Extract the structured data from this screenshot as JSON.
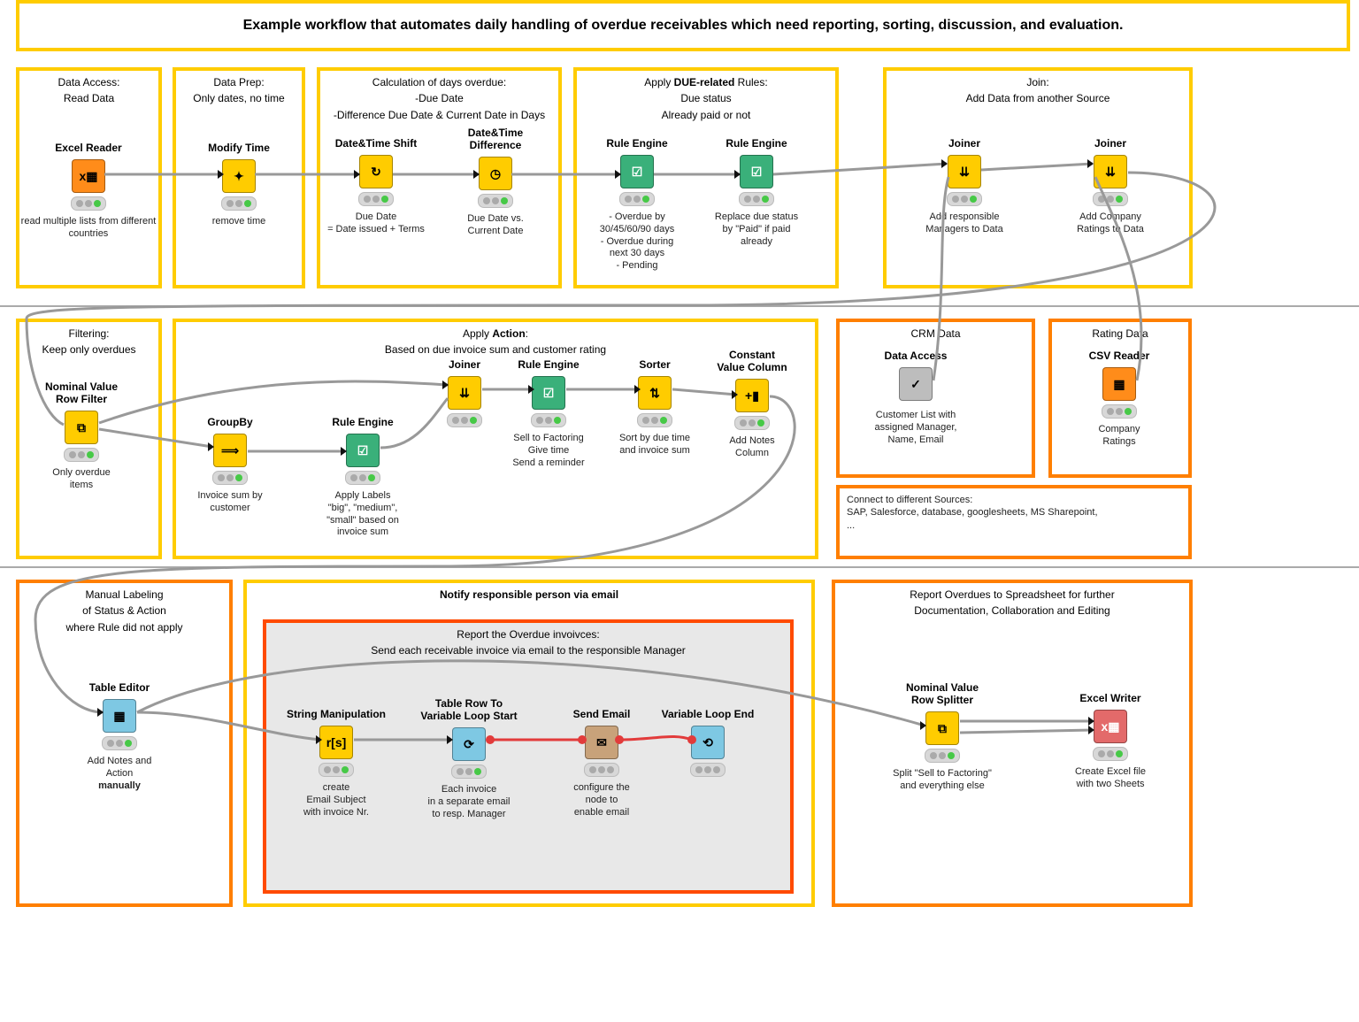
{
  "title": "Example workflow that automates daily handling of overdue receivables which need reporting, sorting, discussion, and evaluation.",
  "zones": {
    "z1": {
      "l1": "Data Access:",
      "l2": "Read Data"
    },
    "z2": {
      "l1": "Data Prep:",
      "l2": "Only dates, no time"
    },
    "z3": {
      "l1": "Calculation of days overdue:",
      "l2": "-Due Date",
      "l3": "-Difference Due Date & Current Date in Days"
    },
    "z4": {
      "l1": "Apply DUE-related Rules:",
      "l2": "Due status",
      "l3": "Already paid or not"
    },
    "z5": {
      "l1": "Join:",
      "l2": "Add Data from another Source"
    },
    "z6": {
      "l1": "Filtering:",
      "l2": "Keep only overdues"
    },
    "z7": {
      "l1": "Apply Action:",
      "l2": "Based on due invoice sum and customer rating"
    },
    "z8": {
      "l1": "CRM Data"
    },
    "z9": {
      "l1": "Rating Data"
    },
    "z10": {
      "l1": "Manual Labeling",
      "l2": "of Status & Action",
      "l3": "where Rule did not apply"
    },
    "z11": {
      "l1": "Notify responsible person via email"
    },
    "z11b": {
      "l1": "Report the Overdue invoivces:",
      "l2": "Send each receivable invoice via email to the responsible Manager"
    },
    "z12": {
      "l1": "Report Overdues to Spreadsheet for further",
      "l2": "Documentation, Collaboration and Editing"
    },
    "src": {
      "l1": "Connect to different Sources:",
      "l2": "SAP, Salesforce, database, googlesheets, MS Sharepoint,",
      "l3": "..."
    }
  },
  "nodes": {
    "excel": {
      "t": "Excel Reader",
      "d": "read multiple lists from different countries"
    },
    "modtime": {
      "t": "Modify Time",
      "d": "remove time"
    },
    "dtshift": {
      "t": "Date&Time Shift",
      "d": "Due Date\n= Date issued + Terms"
    },
    "dtdiff": {
      "t": "Date&Time\nDifference",
      "d": "Due Date vs.\nCurrent Date"
    },
    "rule1": {
      "t": "Rule Engine",
      "d": "- Overdue by\n30/45/60/90 days\n- Overdue during\nnext 30 days\n- Pending"
    },
    "rule2": {
      "t": "Rule Engine",
      "d": "Replace due status\nby \"Paid\" if paid\nalready"
    },
    "join1": {
      "t": "Joiner",
      "d": "Add responsible\nManagers to Data"
    },
    "join2": {
      "t": "Joiner",
      "d": "Add Company\nRatings to Data"
    },
    "nvf": {
      "t": "Nominal Value\nRow Filter",
      "d": "Only overdue\nitems"
    },
    "groupby": {
      "t": "GroupBy",
      "d": "Invoice sum by\ncustomer"
    },
    "rule3": {
      "t": "Rule Engine",
      "d": "Apply Labels\n\"big\", \"medium\",\n\"small\" based on\ninvoice sum"
    },
    "join3": {
      "t": "Joiner",
      "d": ""
    },
    "rule4": {
      "t": "Rule Engine",
      "d": "Sell to Factoring\nGive time\nSend a reminder"
    },
    "sorter": {
      "t": "Sorter",
      "d": "Sort by due time\nand invoice sum"
    },
    "constcol": {
      "t": "Constant\nValue Column",
      "d": "Add Notes\nColumn"
    },
    "dacc": {
      "t": "Data Access",
      "d": "Customer List with\nassigned Manager,\nName, Email"
    },
    "csvr": {
      "t": "CSV Reader",
      "d": "Company\nRatings"
    },
    "tedit": {
      "t": "Table Editor",
      "d": "Add Notes and\nAction\nmanually"
    },
    "strman": {
      "t": "String Manipulation",
      "d": "create\nEmail Subject\nwith invoice Nr."
    },
    "tloop": {
      "t": "Table Row To\nVariable Loop Start",
      "d": "Each invoice\nin a separate email\nto resp. Manager"
    },
    "semail": {
      "t": "Send Email",
      "d": "configure the\nnode to\nenable email"
    },
    "vloop": {
      "t": "Variable Loop End",
      "d": ""
    },
    "nvsplit": {
      "t": "Nominal Value\nRow Splitter",
      "d": "Split \"Sell to Factoring\"\nand everything else"
    },
    "xlswrite": {
      "t": "Excel Writer",
      "d": "Create Excel file\nwith two Sheets"
    }
  },
  "diagram_notes": {
    "sep_rows": [
      345,
      640
    ],
    "colors": {
      "yellow": "#ffcc00",
      "orange": "#ff7f00",
      "deep_orange": "#ff4a00"
    }
  }
}
